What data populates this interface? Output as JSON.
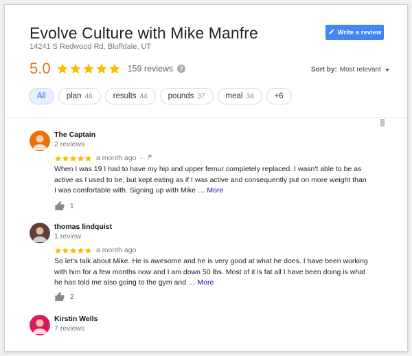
{
  "business": {
    "title": "Evolve Culture with Mike Manfre",
    "address": "14241 S Redwood Rd, Bluffdale, UT",
    "write_review_label": "Write a review"
  },
  "summary": {
    "rating": "5.0",
    "stars": 5,
    "review_count": "159 reviews"
  },
  "sort": {
    "label": "Sort by:",
    "value": "Most relevant"
  },
  "chips": [
    {
      "label": "All",
      "count": ""
    },
    {
      "label": "plan",
      "count": "46"
    },
    {
      "label": "results",
      "count": "44"
    },
    {
      "label": "pounds",
      "count": "37"
    },
    {
      "label": "meal",
      "count": "34"
    },
    {
      "label": "+6",
      "count": ""
    }
  ],
  "reviews": [
    {
      "name": "The Captain",
      "count": "2 reviews",
      "time": "a month ago",
      "sep": "-",
      "text": "When I was 19 I had to have my hip and upper  femur completely replaced. I wasn't able to be as active as I used to be, but kept eating as if I was active and consequently put on more weight than I was comfortable with. Signing up with Mike …",
      "more": "More",
      "likes": "1",
      "avatar_color": "#e8710a"
    },
    {
      "name": "thomas lindquist",
      "count": "1 review",
      "time": "a month ago",
      "text": "So let's talk about Mike. He is awesome and he is very good at what he does. I have been working with him for a few months now and I am down 50 lbs.  Most of it is fat all I have been doing is what he has told me also going to the gym and …",
      "more": "More",
      "likes": "2",
      "avatar_color": "#5d4037"
    },
    {
      "name": "Kirstin Wells",
      "count": "7 reviews",
      "avatar_color": "#d81b60"
    }
  ],
  "colors": {
    "star": "#fbbc04",
    "accent": "#4285f4",
    "rating": "#e7711b"
  }
}
